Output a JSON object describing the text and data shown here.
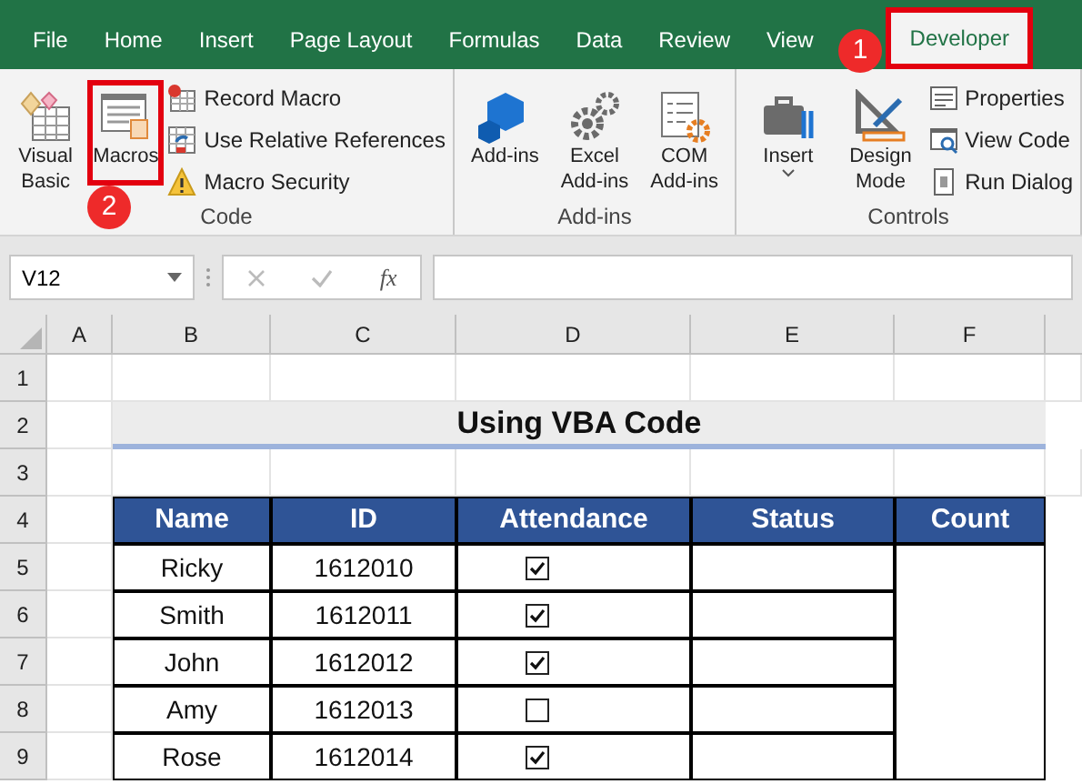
{
  "tabs": [
    {
      "label": "File",
      "selected": false
    },
    {
      "label": "Home",
      "selected": false
    },
    {
      "label": "Insert",
      "selected": false
    },
    {
      "label": "Page Layout",
      "selected": false
    },
    {
      "label": "Formulas",
      "selected": false
    },
    {
      "label": "Data",
      "selected": false
    },
    {
      "label": "Review",
      "selected": false
    },
    {
      "label": "View",
      "selected": false
    },
    {
      "label": "Developer",
      "selected": true
    }
  ],
  "ribbon_groups": [
    {
      "label": "Code",
      "buttons": [
        {
          "kind": "large",
          "label": "Visual Basic",
          "highlighted": false
        },
        {
          "kind": "large",
          "label": "Macros",
          "highlighted": true
        },
        {
          "kind": "small",
          "label": "Record Macro"
        },
        {
          "kind": "small",
          "label": "Use Relative References"
        },
        {
          "kind": "small",
          "label": "Macro Security"
        }
      ]
    },
    {
      "label": "Add-ins",
      "buttons": [
        {
          "kind": "large",
          "label": "Add-ins",
          "highlighted": false
        },
        {
          "kind": "large",
          "label": "Excel Add-ins",
          "highlighted": false
        },
        {
          "kind": "large",
          "label": "COM Add-ins",
          "highlighted": false
        }
      ]
    },
    {
      "label": "Controls",
      "buttons": [
        {
          "kind": "menu",
          "label": "Insert",
          "highlighted": false
        },
        {
          "kind": "large",
          "label": "Design Mode",
          "highlighted": false
        },
        {
          "kind": "small",
          "label": "Properties"
        },
        {
          "kind": "small",
          "label": "View Code"
        },
        {
          "kind": "small",
          "label": "Run Dialog"
        }
      ]
    }
  ],
  "step_badges": [
    "1",
    "2"
  ],
  "formula_bar": {
    "name_box": "V12",
    "function_label": "fx"
  },
  "column_headers": [
    "A",
    "B",
    "C",
    "D",
    "E",
    "F"
  ],
  "row_numbers": [
    "1",
    "2",
    "3",
    "4",
    "5",
    "6",
    "7",
    "8",
    "9"
  ],
  "sheet_title": "Using VBA Code",
  "table": {
    "columns": [
      "Name",
      "ID",
      "Attendance",
      "Status",
      "Count"
    ],
    "rows": [
      {
        "name": "Ricky",
        "id": "1612010",
        "checked": true
      },
      {
        "name": "Smith",
        "id": "1612011",
        "checked": true
      },
      {
        "name": "John",
        "id": "1612012",
        "checked": true
      },
      {
        "name": "Amy",
        "id": "1612013",
        "checked": false
      },
      {
        "name": "Rose",
        "id": "1612014",
        "checked": true
      }
    ]
  }
}
